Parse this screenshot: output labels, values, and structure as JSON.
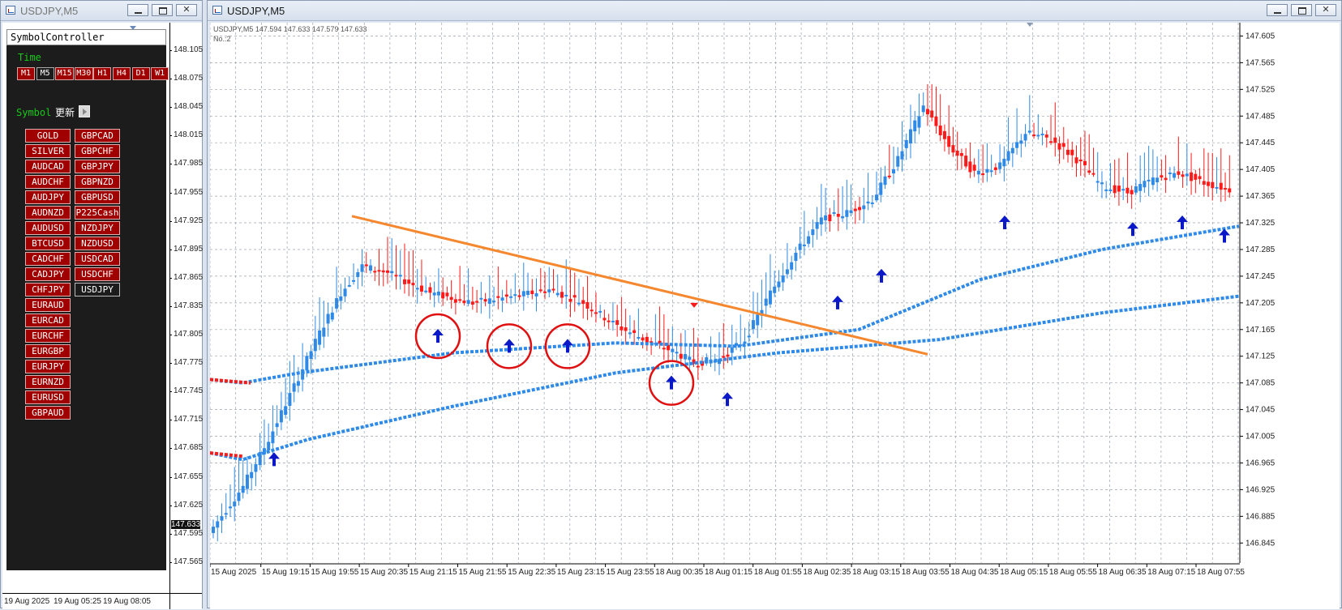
{
  "left_window": {
    "title": "USDJPY,M5",
    "controller": {
      "title": "SymbolController",
      "time_label": "Time",
      "timeframes": [
        "M1",
        "M5",
        "M15",
        "M30",
        "H1",
        "H4",
        "D1",
        "W1"
      ],
      "selected_timeframe": "M5",
      "symbol_label": "Symbol",
      "update_label": "更新",
      "symbols_left": [
        "GOLD",
        "SILVER",
        "AUDCAD",
        "AUDCHF",
        "AUDJPY",
        "AUDNZD",
        "AUDUSD",
        "BTCUSD",
        "CADCHF",
        "CADJPY",
        "CHFJPY",
        "EURAUD",
        "EURCAD",
        "EURCHF",
        "EURGBP",
        "EURJPY",
        "EURNZD",
        "EURUSD",
        "GBPAUD"
      ],
      "symbols_right": [
        "GBPCAD",
        "GBPCHF",
        "GBPJPY",
        "GBPNZD",
        "GBPUSD",
        "P225Cash",
        "NZDJPY",
        "NZDUSD",
        "USDCAD",
        "USDCHF",
        "USDJPY"
      ],
      "selected_symbol": "USDJPY"
    },
    "price_ladder": [
      "148.105",
      "148.075",
      "148.045",
      "148.015",
      "147.985",
      "147.955",
      "147.925",
      "147.895",
      "147.865",
      "147.835",
      "147.805",
      "147.775",
      "147.745",
      "147.715",
      "147.685",
      "147.655",
      "147.625",
      "147.595",
      "147.565"
    ],
    "current_price": "147.633",
    "time_labels": [
      "19 Aug 2025",
      "19 Aug 05:25",
      "19 Aug 08:05"
    ]
  },
  "main_window": {
    "title": "USDJPY,M5",
    "ohlc_header": "USDJPY,M5  147.594 147.633 147.579 147.633",
    "subwindow_label": "No.:2",
    "price_axis": [
      "147.605",
      "147.565",
      "147.525",
      "147.485",
      "147.445",
      "147.405",
      "147.365",
      "147.325",
      "147.285",
      "147.245",
      "147.205",
      "147.165",
      "147.125",
      "147.085",
      "147.045",
      "147.005",
      "146.965",
      "146.925",
      "146.885",
      "146.845"
    ],
    "time_axis": [
      "15 Aug 2025",
      "15 Aug 19:15",
      "15 Aug 19:55",
      "15 Aug 20:35",
      "15 Aug 21:15",
      "15 Aug 21:55",
      "15 Aug 22:35",
      "15 Aug 23:15",
      "15 Aug 23:55",
      "18 Aug 00:35",
      "18 Aug 01:15",
      "18 Aug 01:55",
      "18 Aug 02:35",
      "18 Aug 03:15",
      "18 Aug 03:55",
      "18 Aug 04:35",
      "18 Aug 05:15",
      "18 Aug 05:55",
      "18 Aug 06:35",
      "18 Aug 07:15",
      "18 Aug 07:55"
    ]
  },
  "colors": {
    "bull": "#2e8ae6",
    "bear": "#ff1a1a",
    "trendline": "#f5872e",
    "circle": "#e01010",
    "arrow": "#0a18c8",
    "grid": "#9aa3ad"
  },
  "icons": [
    "window-icon",
    "minimize-icon",
    "maximize-icon",
    "close-icon",
    "up-arrow-icon",
    "down-arrow-icon"
  ]
}
